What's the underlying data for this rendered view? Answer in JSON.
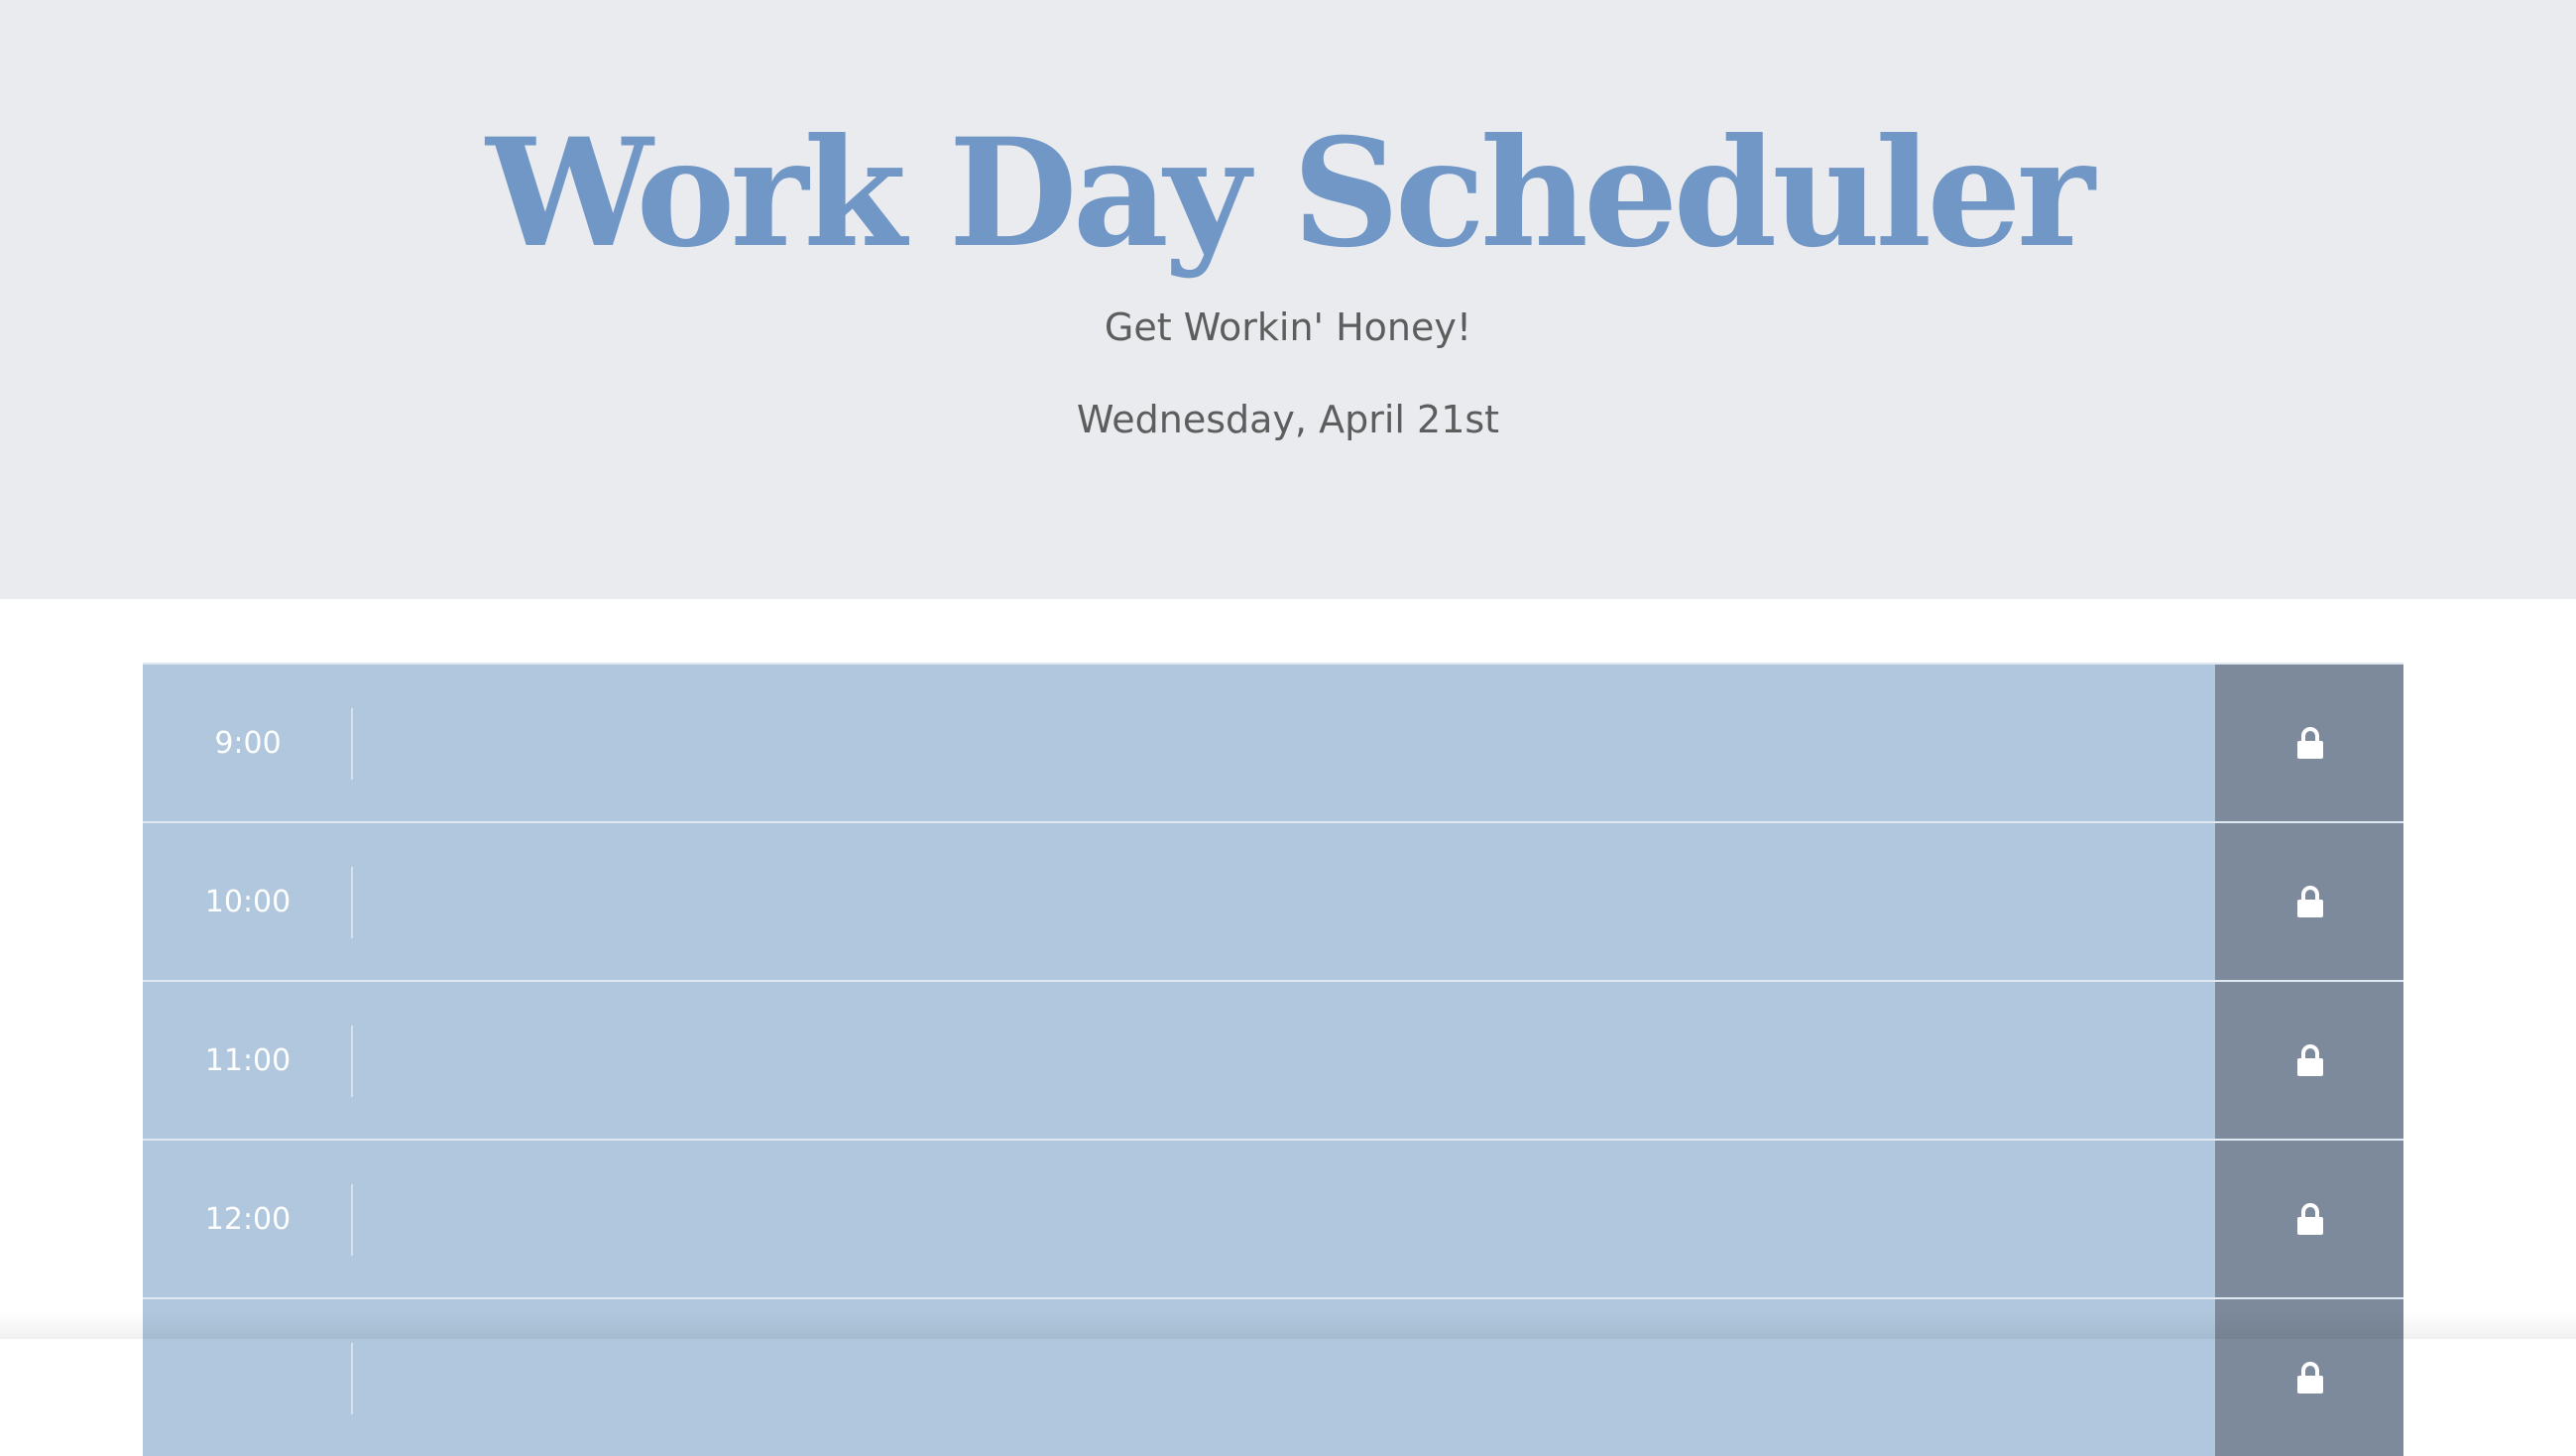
{
  "header": {
    "title": "Work Day Scheduler",
    "subtitle": "Get Workin' Honey!",
    "current_day": "Wednesday, April 21st"
  },
  "time_blocks": [
    {
      "hour": "9:00",
      "description": "",
      "save_icon": "lock-icon"
    },
    {
      "hour": "10:00",
      "description": "",
      "save_icon": "lock-icon"
    },
    {
      "hour": "11:00",
      "description": "",
      "save_icon": "lock-icon"
    },
    {
      "hour": "12:00",
      "description": "",
      "save_icon": "lock-icon"
    },
    {
      "hour": "",
      "description": "",
      "save_icon": "lock-icon"
    }
  ],
  "colors": {
    "header_bg": "#e9ebef",
    "title": "#7197c7",
    "text": "#5d5d5d",
    "block_bg": "#b0c7dd",
    "save_bg": "#7d8a9b"
  }
}
